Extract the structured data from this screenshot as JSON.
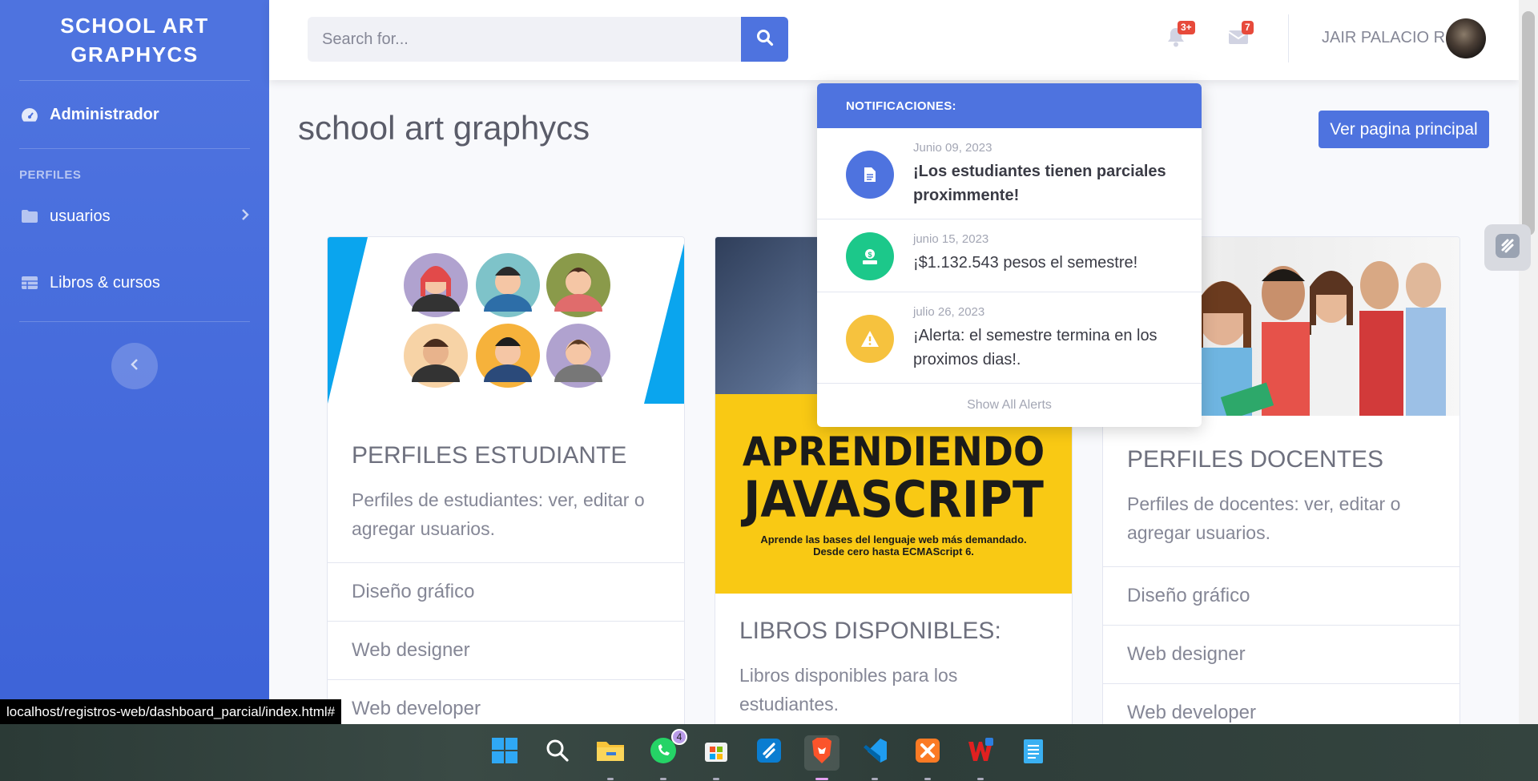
{
  "sidebar": {
    "brand": "SCHOOL ART GRAPHYCS",
    "admin_label": "Administrador",
    "heading": "PERFILES",
    "items": [
      {
        "label": "usuarios"
      },
      {
        "label": "Libros & cursos"
      }
    ]
  },
  "topbar": {
    "search_placeholder": "Search for...",
    "alerts_badge": "3+",
    "messages_badge": "7",
    "user_name": "JAIR PALACIO R"
  },
  "page": {
    "title": "school art graphycs",
    "main_button": "Ver pagina principal"
  },
  "cards": [
    {
      "title": "PERFILES ESTUDIANTE",
      "text": "Perfiles de estudiantes: ver, editar o agregar usuarios.",
      "list": [
        "Diseño gráfico",
        "Web designer",
        "Web developer"
      ]
    },
    {
      "book_title_1": "APRENDIENDO",
      "book_title_2": "JAVASCRIPT",
      "book_subtitle_1": "Aprende las bases del lenguaje web más demandado.",
      "book_subtitle_2": "Desde cero hasta ECMAScript 6.",
      "title": "LIBROS DISPONIBLES:",
      "text": "Libros disponibles para los estudiantes."
    },
    {
      "title": "PERFILES DOCENTES",
      "text": "Perfiles de docentes: ver, editar o agregar usuarios.",
      "list": [
        "Diseño gráfico",
        "Web designer",
        "Web developer"
      ]
    }
  ],
  "notifications": {
    "header": "NOTIFICACIONES:",
    "items": [
      {
        "date": "Junio 09, 2023",
        "text": "¡Los estudiantes tienen parciales proximmente!",
        "color": "#4e73df",
        "icon": "file-icon"
      },
      {
        "date": "junio 15, 2023",
        "text": "¡$1.132.543 pesos el semestre!",
        "color": "#1cc88a",
        "icon": "donate-icon"
      },
      {
        "date": "julio 26, 2023",
        "text": "¡Alerta: el semestre termina en los proximos dias!.",
        "color": "#f6c23e",
        "icon": "warning-icon"
      }
    ],
    "footer": "Show All Alerts"
  },
  "statusbar": {
    "url": "localhost/registros-web/dashboard_parcial/index.html#"
  },
  "taskbar": {
    "whatsapp_count": "4"
  }
}
